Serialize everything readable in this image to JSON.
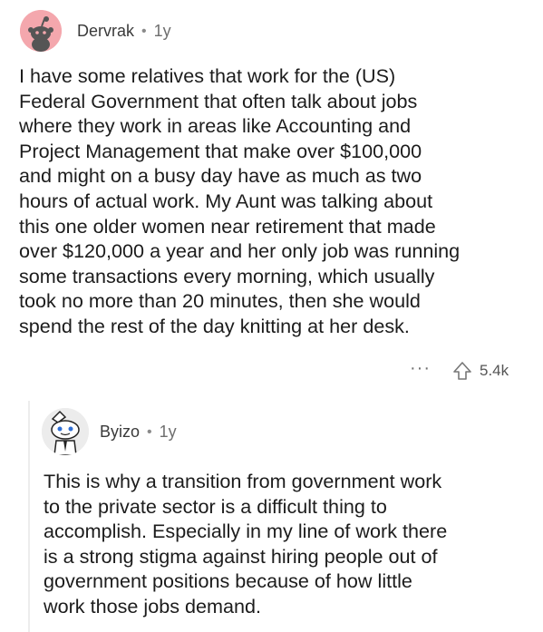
{
  "parent_comment": {
    "username": "Dervrak",
    "separator": "•",
    "age": "1y",
    "avatar": "snoo-avatar-pink",
    "lines": [
      "I have some relatives that work for the (US)",
      "Federal Government that often talk about jobs",
      "where they work in areas like Accounting and",
      "Project Management that make over $100,000",
      "and might on a busy day have as much as two",
      "hours of actual work.  My Aunt was talking about",
      "this one older women near retirement that made",
      "over $120,000 a year and her only job was running",
      "some transactions every morning, which usually",
      "took no more than 20 minutes, then she would",
      "spend the rest of the day knitting at her desk."
    ],
    "more_label": "···",
    "upvote_icon": "upvote-arrow-icon",
    "score": "5.4k"
  },
  "reply_comment": {
    "username": "Byizo",
    "separator": "•",
    "age": "1y",
    "avatar": "snoo-avatar-cartoon",
    "lines": [
      "This is why a transition from government work",
      "to the private sector is a difficult thing to",
      "accomplish. Especially in my line of work there",
      "is a strong stigma against hiring people out of",
      "government positions because of how little",
      "work those jobs demand."
    ]
  },
  "colors": {
    "avatar_pink": "#f4a7ad",
    "text": "#1c1c1c",
    "meta": "#4a4a4a",
    "thread_line": "#ededed"
  }
}
